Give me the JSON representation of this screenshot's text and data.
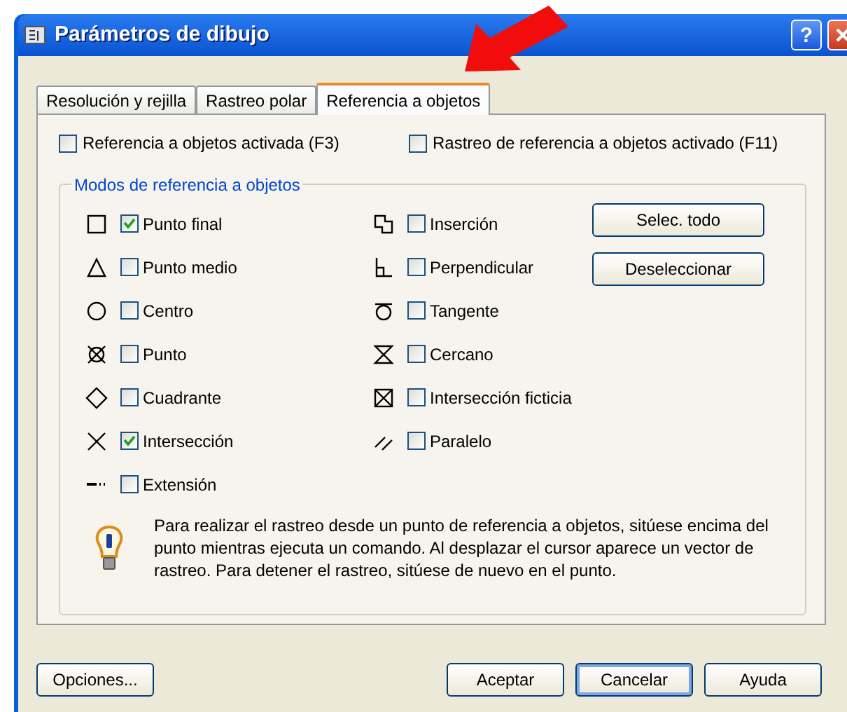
{
  "window": {
    "title": "Parámetros de dibujo",
    "help_label": "?"
  },
  "tabs": [
    {
      "label": "Resolución y rejilla",
      "selected": false
    },
    {
      "label": "Rastreo polar",
      "selected": false
    },
    {
      "label": "Referencia a objetos",
      "selected": true
    }
  ],
  "top_options": [
    {
      "label": "Referencia a objetos activada (F3)",
      "checked": false
    },
    {
      "label": "Rastreo de referencia a objetos activado (F11)",
      "checked": false
    }
  ],
  "modes_group": {
    "title": "Modos de referencia a objetos",
    "left_column": [
      {
        "kind": "endpoint",
        "label": "Punto final",
        "checked": true
      },
      {
        "kind": "midpoint",
        "label": "Punto medio",
        "checked": false
      },
      {
        "kind": "center",
        "label": "Centro",
        "checked": false
      },
      {
        "kind": "node",
        "label": "Punto",
        "checked": false
      },
      {
        "kind": "quadrant",
        "label": "Cuadrante",
        "checked": false
      },
      {
        "kind": "intersection",
        "label": "Intersección",
        "checked": true
      },
      {
        "kind": "extension",
        "label": "Extensión",
        "checked": false
      }
    ],
    "right_column": [
      {
        "kind": "insertion",
        "label": "Inserción",
        "checked": false
      },
      {
        "kind": "perpendicular",
        "label": "Perpendicular",
        "checked": false
      },
      {
        "kind": "tangent",
        "label": "Tangente",
        "checked": false
      },
      {
        "kind": "nearest",
        "label": "Cercano",
        "checked": false
      },
      {
        "kind": "apparent",
        "label": "Intersección ficticia",
        "checked": false
      },
      {
        "kind": "parallel",
        "label": "Paralelo",
        "checked": false
      }
    ],
    "buttons": [
      "Selec. todo",
      "Deseleccionar"
    ],
    "hint": "Para realizar el rastreo desde un punto de referencia a objetos, sitúese encima del punto mientras ejecuta un comando. Al desplazar el cursor aparece un vector de rastreo. Para detener el rastreo, sitúese de nuevo en el punto."
  },
  "footer": {
    "left_button": "Opciones...",
    "buttons": [
      {
        "label": "Aceptar",
        "default": false
      },
      {
        "label": "Cancelar",
        "default": true
      },
      {
        "label": "Ayuda",
        "default": false
      }
    ]
  }
}
